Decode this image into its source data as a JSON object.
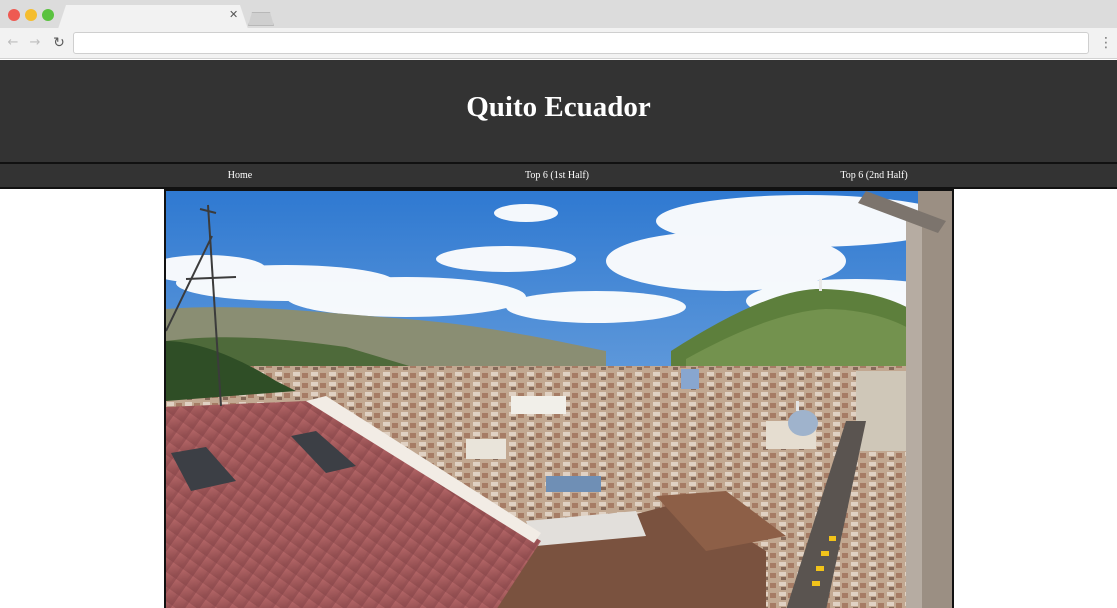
{
  "browser": {
    "tab": {
      "title": ""
    },
    "address_bar": {
      "value": "",
      "placeholder": ""
    }
  },
  "header": {
    "title": "Quito Ecuador"
  },
  "nav": {
    "items": [
      {
        "label": "Home"
      },
      {
        "label": "Top 6 (1st Half)"
      },
      {
        "label": "Top 6 (2nd Half)"
      }
    ]
  },
  "hero": {
    "alt": ""
  },
  "colors": {
    "header_bg": "#333333",
    "nav_bg": "#333333",
    "title_text": "#ffffff",
    "page_bg": "#ffffff"
  },
  "icons": {
    "close": "close-icon",
    "back": "back-arrow-icon",
    "forward": "forward-arrow-icon",
    "reload": "reload-icon",
    "menu": "kebab-menu-icon"
  }
}
